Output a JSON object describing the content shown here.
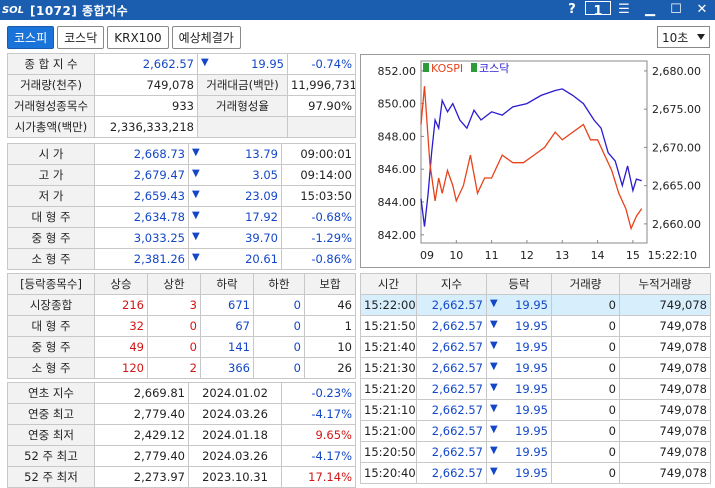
{
  "window": {
    "logo": "SOL",
    "title": "[1072] 종합지수",
    "help": "?",
    "one": "1"
  },
  "tabs": [
    "코스피",
    "코스닥",
    "KRX100",
    "예상체결가"
  ],
  "interval": "10초",
  "summary": {
    "r1": {
      "label": "종 합 지 수",
      "value": "2,662.57",
      "change": "19.95",
      "rate": "-0.74%"
    },
    "r2": {
      "label": "거래량(천주)",
      "value": "749,078",
      "label2": "거래대금(백만)",
      "value2": "11,996,731"
    },
    "r3": {
      "label": "거래형성종목수",
      "value": "933",
      "label2": "거래형성율",
      "value2": "97.90%"
    },
    "r4": {
      "label": "시가총액(백만)",
      "value": "2,336,333,218"
    }
  },
  "prices": [
    {
      "label": "시 가",
      "value": "2,668.73",
      "change": "13.79",
      "extra": "09:00:01",
      "ec": ""
    },
    {
      "label": "고 가",
      "value": "2,679.47",
      "change": "3.05",
      "extra": "09:14:00",
      "ec": ""
    },
    {
      "label": "저 가",
      "value": "2,659.43",
      "change": "23.09",
      "extra": "15:03:50",
      "ec": ""
    },
    {
      "label": "대 형 주",
      "value": "2,634.78",
      "change": "17.92",
      "extra": "-0.68%",
      "ec": "blue"
    },
    {
      "label": "중 형 주",
      "value": "3,033.25",
      "change": "39.70",
      "extra": "-1.29%",
      "ec": "blue"
    },
    {
      "label": "소 형 주",
      "value": "2,381.26",
      "change": "20.61",
      "extra": "-0.86%",
      "ec": "blue"
    }
  ],
  "breadth": {
    "headers": [
      "[등락종목수]",
      "상승",
      "상한",
      "하락",
      "하한",
      "보합"
    ],
    "rows": [
      [
        "시장종합",
        "216",
        "3",
        "671",
        "0",
        "46"
      ],
      [
        "대 형 주",
        "32",
        "0",
        "67",
        "0",
        "1"
      ],
      [
        "중 형 주",
        "49",
        "0",
        "141",
        "0",
        "10"
      ],
      [
        "소 형 주",
        "120",
        "2",
        "366",
        "0",
        "26"
      ]
    ]
  },
  "extremes": [
    {
      "label": "연초 지수",
      "value": "2,669.81",
      "date": "2024.01.02",
      "rate": "-0.23%",
      "rc": "blue"
    },
    {
      "label": "연중 최고",
      "value": "2,779.40",
      "date": "2024.03.26",
      "rate": "-4.17%",
      "rc": "blue"
    },
    {
      "label": "연중 최저",
      "value": "2,429.12",
      "date": "2024.01.18",
      "rate": "9.65%",
      "rc": "red"
    },
    {
      "label": "52 주 최고",
      "value": "2,779.40",
      "date": "2024.03.26",
      "rate": "-4.17%",
      "rc": "blue"
    },
    {
      "label": "52 주 최저",
      "value": "2,273.97",
      "date": "2023.10.31",
      "rate": "17.14%",
      "rc": "red"
    }
  ],
  "ticks": {
    "headers": [
      "시간",
      "지수",
      "등락",
      "거래량",
      "누적거래량"
    ],
    "rows": [
      [
        "15:22:00",
        "2,662.57",
        "19.95",
        "0",
        "749,078"
      ],
      [
        "15:21:50",
        "2,662.57",
        "19.95",
        "0",
        "749,078"
      ],
      [
        "15:21:40",
        "2,662.57",
        "19.95",
        "0",
        "749,078"
      ],
      [
        "15:21:30",
        "2,662.57",
        "19.95",
        "0",
        "749,078"
      ],
      [
        "15:21:20",
        "2,662.57",
        "19.95",
        "0",
        "749,078"
      ],
      [
        "15:21:10",
        "2,662.57",
        "19.95",
        "0",
        "749,078"
      ],
      [
        "15:21:00",
        "2,662.57",
        "19.95",
        "0",
        "749,078"
      ],
      [
        "15:20:50",
        "2,662.57",
        "19.95",
        "0",
        "749,078"
      ],
      [
        "15:20:40",
        "2,662.57",
        "19.95",
        "0",
        "749,078"
      ]
    ]
  },
  "chart_data": {
    "type": "line",
    "legend": [
      "KOSPI",
      "코스닥"
    ],
    "colors": {
      "kospi": "#e8421a",
      "kosdaq": "#2a1bd1"
    },
    "left_axis": {
      "ticks": [
        "852.00",
        "850.00",
        "848.00",
        "846.00",
        "844.00",
        "842.00"
      ],
      "range": [
        841.5,
        852.6
      ]
    },
    "right_axis": {
      "ticks": [
        "2,680.00",
        "2,675.00",
        "2,670.00",
        "2,665.00",
        "2,660.00"
      ],
      "range": [
        2657.5,
        2681.3
      ]
    },
    "x_ticks": [
      "09",
      "10",
      "11",
      "12",
      "13",
      "14",
      "15",
      "15:22:10"
    ],
    "kospi": [
      [
        9.0,
        2673
      ],
      [
        9.1,
        2678
      ],
      [
        9.25,
        2668
      ],
      [
        9.4,
        2663
      ],
      [
        9.5,
        2666
      ],
      [
        9.6,
        2664
      ],
      [
        9.75,
        2667
      ],
      [
        9.9,
        2665
      ],
      [
        10.0,
        2663
      ],
      [
        10.2,
        2665
      ],
      [
        10.4,
        2669
      ],
      [
        10.6,
        2664
      ],
      [
        10.8,
        2666
      ],
      [
        11.0,
        2666
      ],
      [
        11.3,
        2669
      ],
      [
        11.6,
        2668
      ],
      [
        11.9,
        2668
      ],
      [
        12.2,
        2669
      ],
      [
        12.5,
        2670
      ],
      [
        12.8,
        2672
      ],
      [
        13.0,
        2671
      ],
      [
        13.3,
        2672
      ],
      [
        13.6,
        2673
      ],
      [
        13.8,
        2671
      ],
      [
        14.0,
        2671
      ],
      [
        14.2,
        2669
      ],
      [
        14.4,
        2667
      ],
      [
        14.6,
        2664
      ],
      [
        14.8,
        2662
      ],
      [
        14.95,
        2659.4
      ],
      [
        15.1,
        2661
      ],
      [
        15.25,
        2662
      ]
    ],
    "kosdaq": [
      [
        9.0,
        844.2
      ],
      [
        9.1,
        842.5
      ],
      [
        9.2,
        844.5
      ],
      [
        9.3,
        847.0
      ],
      [
        9.4,
        849.0
      ],
      [
        9.5,
        848.5
      ],
      [
        9.6,
        850.2
      ],
      [
        9.75,
        849.5
      ],
      [
        9.9,
        850.0
      ],
      [
        10.1,
        849.0
      ],
      [
        10.3,
        848.5
      ],
      [
        10.5,
        849.6
      ],
      [
        10.7,
        849.0
      ],
      [
        11.0,
        849.5
      ],
      [
        11.3,
        849.3
      ],
      [
        11.6,
        849.8
      ],
      [
        12.0,
        850.0
      ],
      [
        12.4,
        850.5
      ],
      [
        12.8,
        850.8
      ],
      [
        13.0,
        850.9
      ],
      [
        13.3,
        850.5
      ],
      [
        13.6,
        850.0
      ],
      [
        13.9,
        849.0
      ],
      [
        14.1,
        848.5
      ],
      [
        14.3,
        847.0
      ],
      [
        14.5,
        846.5
      ],
      [
        14.7,
        845.0
      ],
      [
        14.85,
        846.2
      ],
      [
        15.0,
        844.7
      ],
      [
        15.1,
        845.4
      ],
      [
        15.25,
        845.3
      ]
    ]
  }
}
